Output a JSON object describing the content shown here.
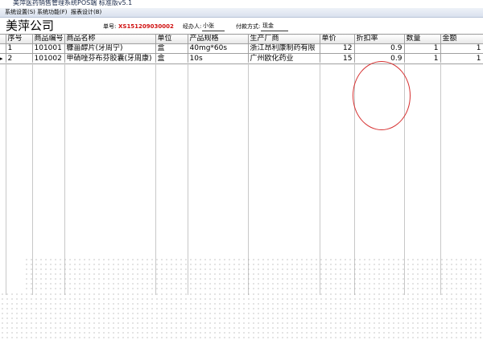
{
  "window": {
    "title": "美萍医药销售管理系统POS端 标准版v5.1"
  },
  "menu": {
    "items": [
      "系统设置(S)",
      "系统功能(F)",
      "报表设计(B)"
    ]
  },
  "header": {
    "company": "美萍公司",
    "order_label": "单号:",
    "order_no": "XS151209030002",
    "operator_label": "经办人:",
    "operator": "小张",
    "payment_label": "付款方式:",
    "payment": "现金"
  },
  "table": {
    "columns": [
      "序号",
      "商品编号",
      "商品名称",
      "单位",
      "产品规格",
      "生产厂商",
      "单价",
      "折扣率",
      "数量",
      "金额"
    ],
    "rows": [
      {
        "seq": "1",
        "code": "101001",
        "name": "糠甾醇片(牙周宁)",
        "unit": "盒",
        "spec": "40mg*60s",
        "maker": "浙江昂利康制药有限",
        "price": "12",
        "discount": "0.9",
        "qty": "1",
        "amount": "1"
      },
      {
        "seq": "2",
        "code": "101002",
        "name": "甲硝唑芬布芬胶囊(牙周康)",
        "unit": "盒",
        "spec": "10s",
        "maker": "广州欧化药业",
        "price": "15",
        "discount": "0.9",
        "qty": "1",
        "amount": "1"
      }
    ]
  },
  "colors": {
    "order_no": "#d01010",
    "highlight_circle": "#d63030"
  }
}
